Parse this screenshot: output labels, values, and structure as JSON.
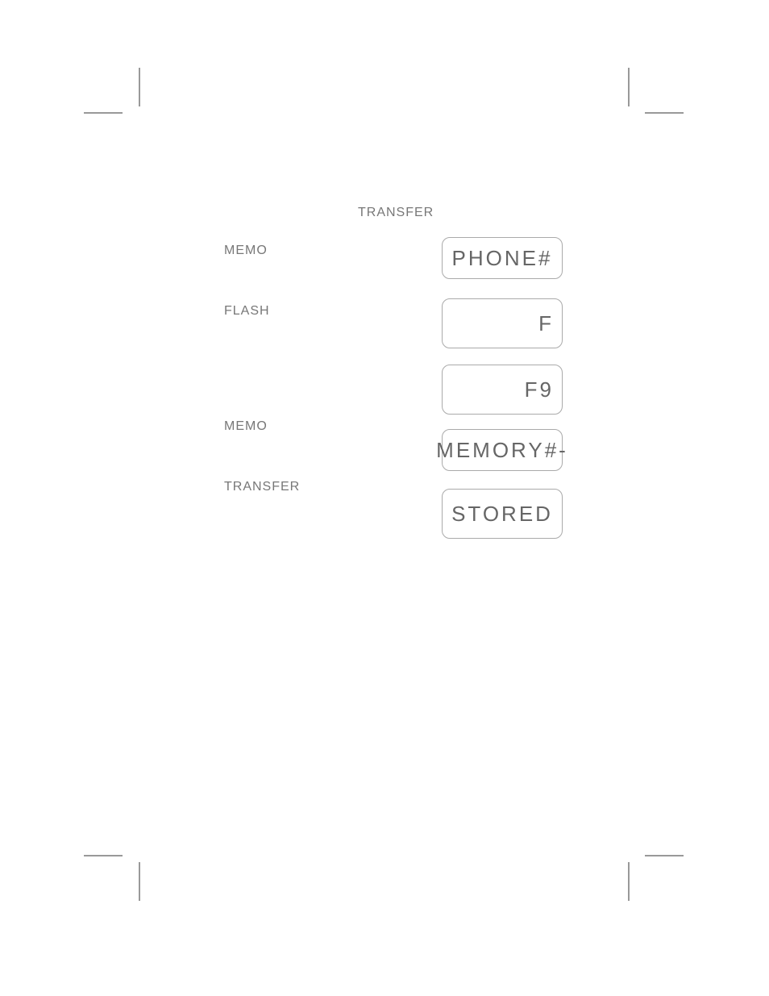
{
  "labels": {
    "transfer_top": "TRANSFER",
    "memo_1": "MEMO",
    "flash": "FLASH",
    "memo_2": "MEMO",
    "transfer_bottom": "TRANSFER"
  },
  "displays": {
    "phone": "PHONE#",
    "f": "F",
    "f9": "F9",
    "memory": "MEMORY#-",
    "stored": "STORED"
  }
}
